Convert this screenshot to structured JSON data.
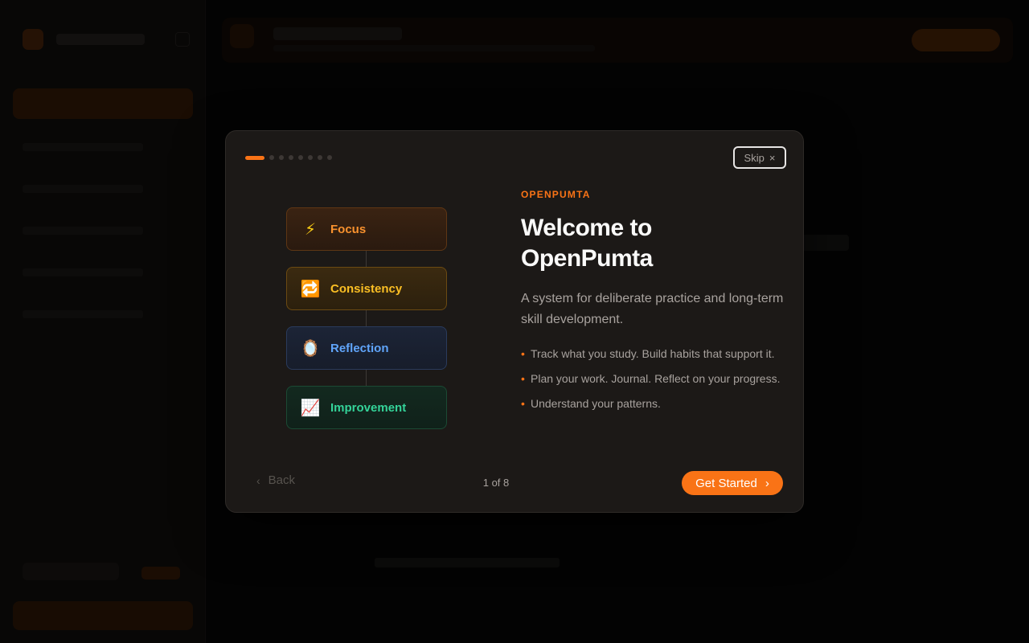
{
  "modal": {
    "progress_total": 8,
    "progress_current": 1,
    "skip_label": "Skip",
    "skip_icon": "×",
    "steps": [
      {
        "icon": "⚡",
        "label": "Focus"
      },
      {
        "icon": "🔁",
        "label": "Consistency"
      },
      {
        "icon": "🪞",
        "label": "Reflection"
      },
      {
        "icon": "📈",
        "label": "Improvement"
      }
    ],
    "eyebrow": "OPENPUMTA",
    "title": "Welcome to OpenPumta",
    "description": "A system for deliberate practice and long-term skill development.",
    "bullets": [
      "Track what you study. Build habits that support it.",
      "Plan your work. Journal. Reflect on your progress.",
      "Understand your patterns."
    ],
    "back_label": "Back",
    "back_icon": "‹",
    "counter": "1 of 8",
    "start_label": "Get Started",
    "start_icon": "›"
  },
  "colors": {
    "accent": "#f97316",
    "modal_bg": "#1c1917",
    "page_bg": "#050505"
  }
}
